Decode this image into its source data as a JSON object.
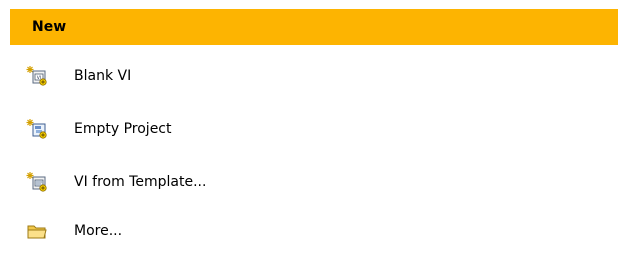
{
  "header": {
    "title": "New"
  },
  "items": [
    {
      "label": "Blank VI",
      "icon": "new-vi-icon"
    },
    {
      "label": "Empty Project",
      "icon": "new-project-icon"
    },
    {
      "label": "VI from Template...",
      "icon": "new-vi-template-icon"
    },
    {
      "label": "More...",
      "icon": "folder-icon"
    }
  ],
  "colors": {
    "header_bg": "#fdb401",
    "text": "#000000"
  }
}
